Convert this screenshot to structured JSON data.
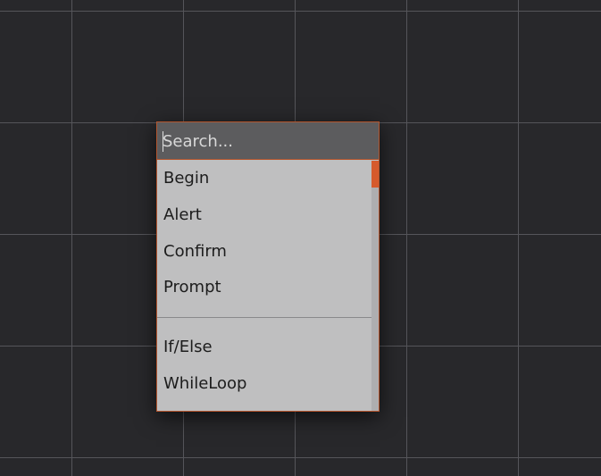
{
  "search": {
    "placeholder": "Search...",
    "value": ""
  },
  "menu": {
    "group_1": [
      "Begin",
      "Alert",
      "Confirm",
      "Prompt"
    ],
    "group_2": [
      "If/Else",
      "WhileLoop"
    ]
  },
  "colors": {
    "canvas_background": "#28282b",
    "grid_line": "#55555a",
    "accent": "#d65a2c",
    "popup_border": "#b3552e",
    "list_background": "#bfbfc0",
    "search_background": "#5c5c5e"
  }
}
